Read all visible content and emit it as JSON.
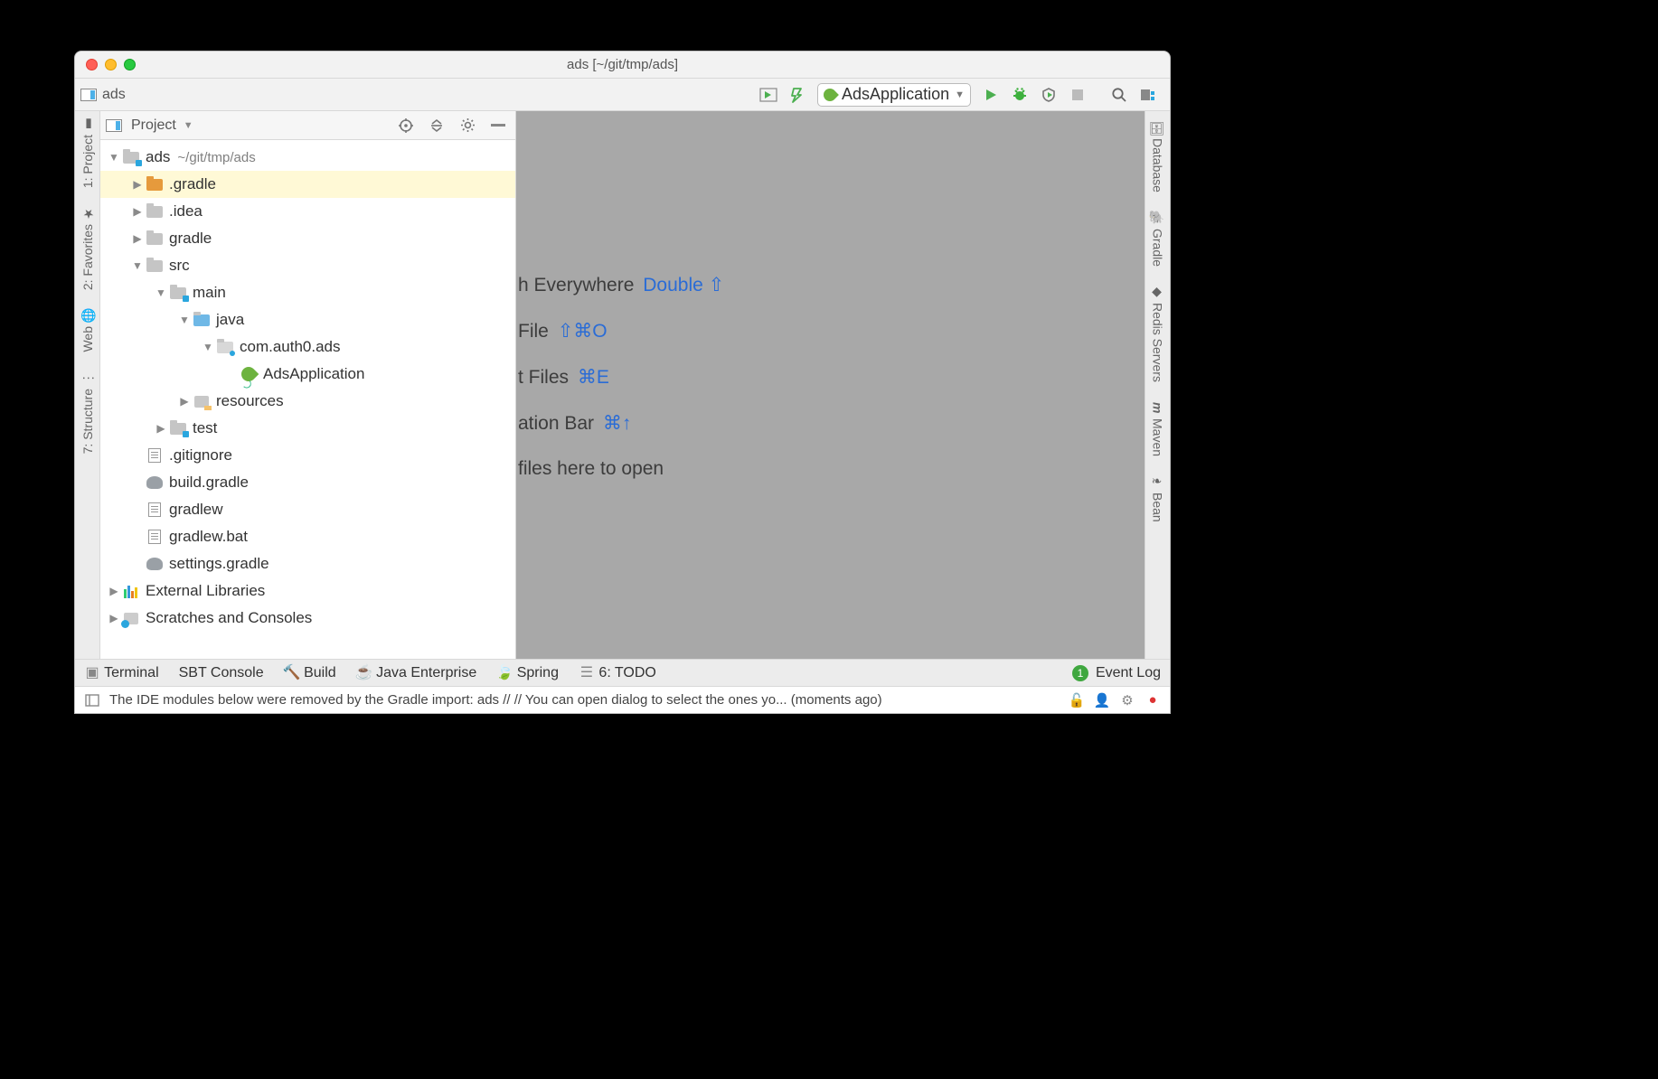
{
  "window": {
    "title": "ads [~/git/tmp/ads]"
  },
  "breadcrumb": {
    "project": "ads"
  },
  "run_config": {
    "name": "AdsApplication"
  },
  "left_gutter": {
    "project": "1: Project",
    "favorites": "2: Favorites",
    "web": "Web",
    "structure": "7: Structure"
  },
  "right_gutter": {
    "database": "Database",
    "gradle": "Gradle",
    "redis": "Redis Servers",
    "maven": "Maven",
    "bean": "Bean"
  },
  "project_panel": {
    "title": "Project",
    "root": {
      "name": "ads",
      "path": "~/git/tmp/ads"
    },
    "items": {
      "gradle_dot": ".gradle",
      "idea": ".idea",
      "gradle": "gradle",
      "src": "src",
      "main": "main",
      "java": "java",
      "pkg": "com.auth0.ads",
      "app": "AdsApplication",
      "resources": "resources",
      "test": "test",
      "gitignore": ".gitignore",
      "build_gradle": "build.gradle",
      "gradlew": "gradlew",
      "gradlew_bat": "gradlew.bat",
      "settings": "settings.gradle",
      "ext_lib": "External Libraries",
      "scratches": "Scratches and Consoles"
    }
  },
  "editor_tips": {
    "search": {
      "text": "h Everywhere",
      "kb": "Double ⇧"
    },
    "file": {
      "text": "File",
      "kb": "⇧⌘O"
    },
    "recent": {
      "text": "t Files",
      "kb": "⌘E"
    },
    "navbar": {
      "text": "ation Bar",
      "kb": "⌘↑"
    },
    "drop": {
      "text": "files here to open"
    }
  },
  "bottom_tools": {
    "terminal": "Terminal",
    "sbt": "SBT Console",
    "build": "Build",
    "javaee": "Java Enterprise",
    "spring": "Spring",
    "todo": "6: TODO",
    "eventlog": "Event Log",
    "event_count": "1"
  },
  "status": {
    "message": "The IDE modules below were removed by the Gradle import: ads // // You can open dialog to select the ones yo... (moments ago)"
  }
}
